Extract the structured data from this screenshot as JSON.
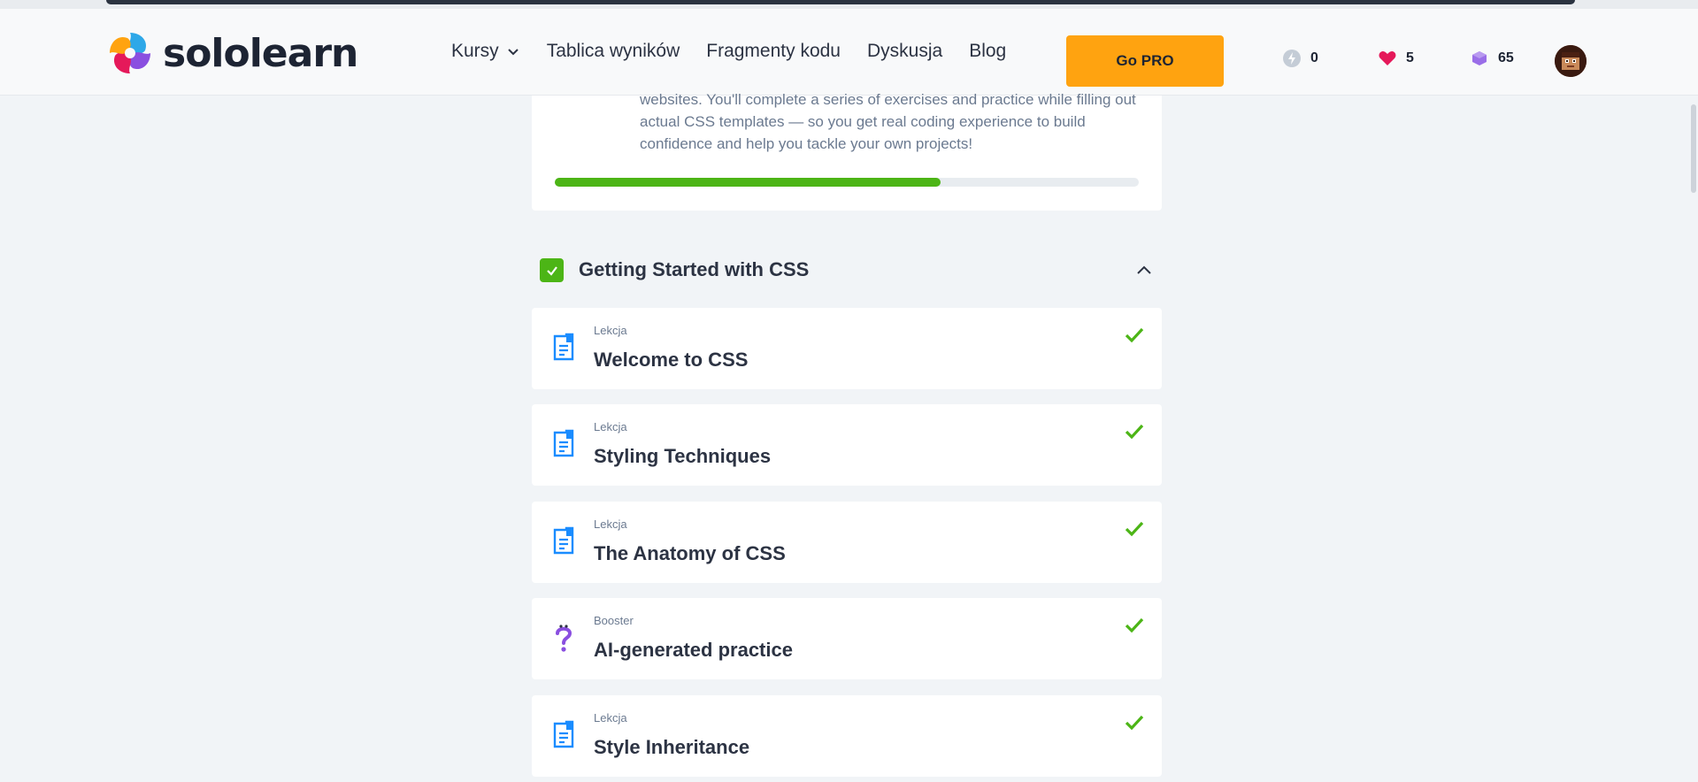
{
  "brand": {
    "name": "sololearn"
  },
  "nav": {
    "items": [
      {
        "label": "Kursy",
        "has_dropdown": true
      },
      {
        "label": "Tablica wyników"
      },
      {
        "label": "Fragmenty kodu"
      },
      {
        "label": "Dyskusja"
      },
      {
        "label": "Blog"
      }
    ],
    "cta_label": "Go PRO"
  },
  "stats": {
    "streak": "0",
    "hearts": "5",
    "gems": "65"
  },
  "course": {
    "description_tail": "websites. You'll complete a series of exercises and practice while filling out actual CSS templates — so you get real coding experience to build confidence and help you tackle your own projects!",
    "progress": 0.66
  },
  "module": {
    "title": "Getting Started with CSS",
    "completed": true,
    "lessons": [
      {
        "kind": "Lekcja",
        "title": "Welcome to CSS",
        "type": "lesson",
        "done": true
      },
      {
        "kind": "Lekcja",
        "title": "Styling Techniques",
        "type": "lesson",
        "done": true
      },
      {
        "kind": "Lekcja",
        "title": "The Anatomy of CSS",
        "type": "lesson",
        "done": true
      },
      {
        "kind": "Booster",
        "title": "AI-generated practice",
        "type": "booster",
        "done": true
      },
      {
        "kind": "Lekcja",
        "title": "Style Inheritance",
        "type": "lesson",
        "done": true
      }
    ]
  },
  "colors": {
    "accent_green": "#4cb516",
    "cta_orange": "#ffa310",
    "lesson_icon_blue": "#1a8cff",
    "booster_purple": "#8a4fe0",
    "heart_pink": "#e5195a"
  }
}
